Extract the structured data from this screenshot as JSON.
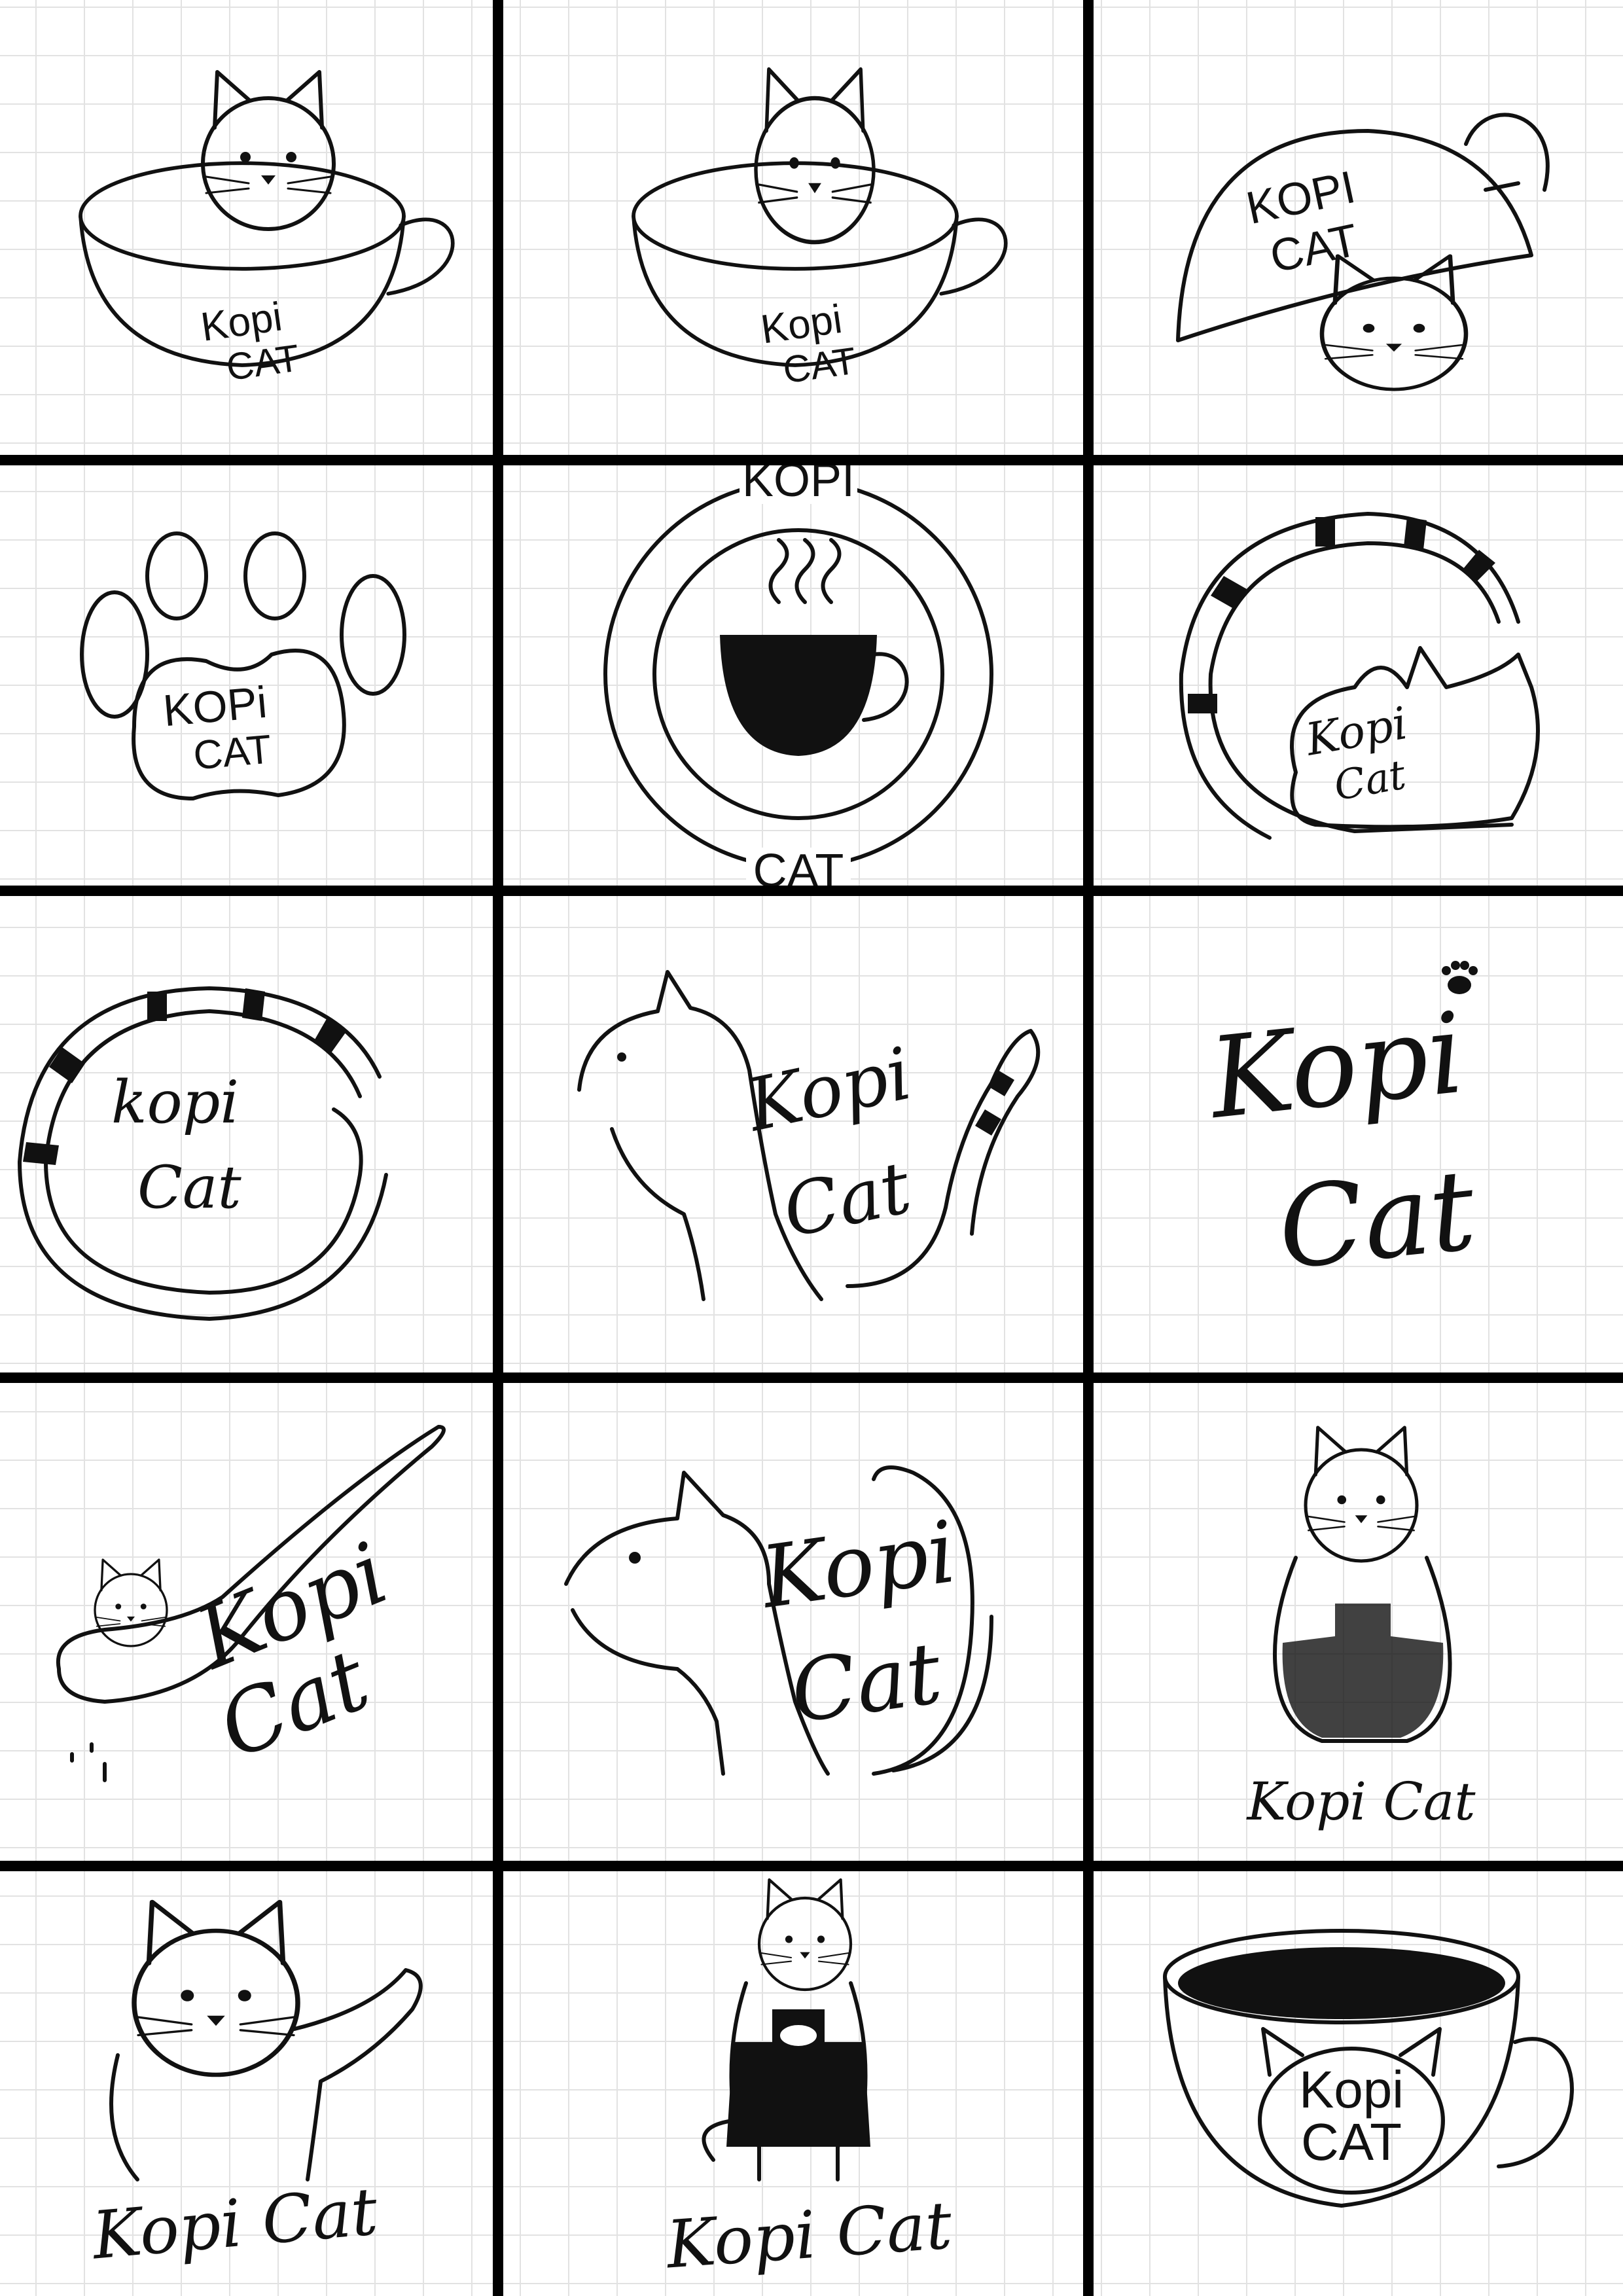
{
  "cells": [
    {
      "concept": "cat-in-cup",
      "lettering": [
        "Kopi",
        "CAT"
      ]
    },
    {
      "concept": "realistic-cat-in-cup",
      "lettering": [
        "Kopi",
        "CAT"
      ]
    },
    {
      "concept": "cup-over-cat",
      "lettering": [
        "KOPI",
        "CAT"
      ]
    },
    {
      "concept": "paw-print",
      "lettering": [
        "KOPi",
        "CAT"
      ]
    },
    {
      "concept": "round-badge-cup",
      "lettering": [
        "KOPI",
        "CAT"
      ]
    },
    {
      "concept": "cat-striped-tail",
      "lettering": [
        "Kopi",
        "Cat"
      ]
    },
    {
      "concept": "striped-tail-ring",
      "lettering": [
        "kopi",
        "Cat"
      ]
    },
    {
      "concept": "cat-profile-tail",
      "lettering": [
        "Kopi",
        "Cat"
      ]
    },
    {
      "concept": "script-paw",
      "lettering": [
        "Kopi",
        "Cat"
      ]
    },
    {
      "concept": "cat-in-spoon",
      "lettering": [
        "Kopi",
        "Cat"
      ]
    },
    {
      "concept": "cat-profile-script",
      "lettering": [
        "Kopi",
        "Cat"
      ]
    },
    {
      "concept": "cat-apron",
      "lettering": [
        "Kopi Cat"
      ]
    },
    {
      "concept": "waving-cat",
      "lettering": [
        "Kopi Cat"
      ]
    },
    {
      "concept": "barista-cat",
      "lettering": [
        "Kopi Cat"
      ]
    },
    {
      "concept": "cup-cat-face",
      "lettering": [
        "Kopi",
        "CAT"
      ]
    }
  ]
}
